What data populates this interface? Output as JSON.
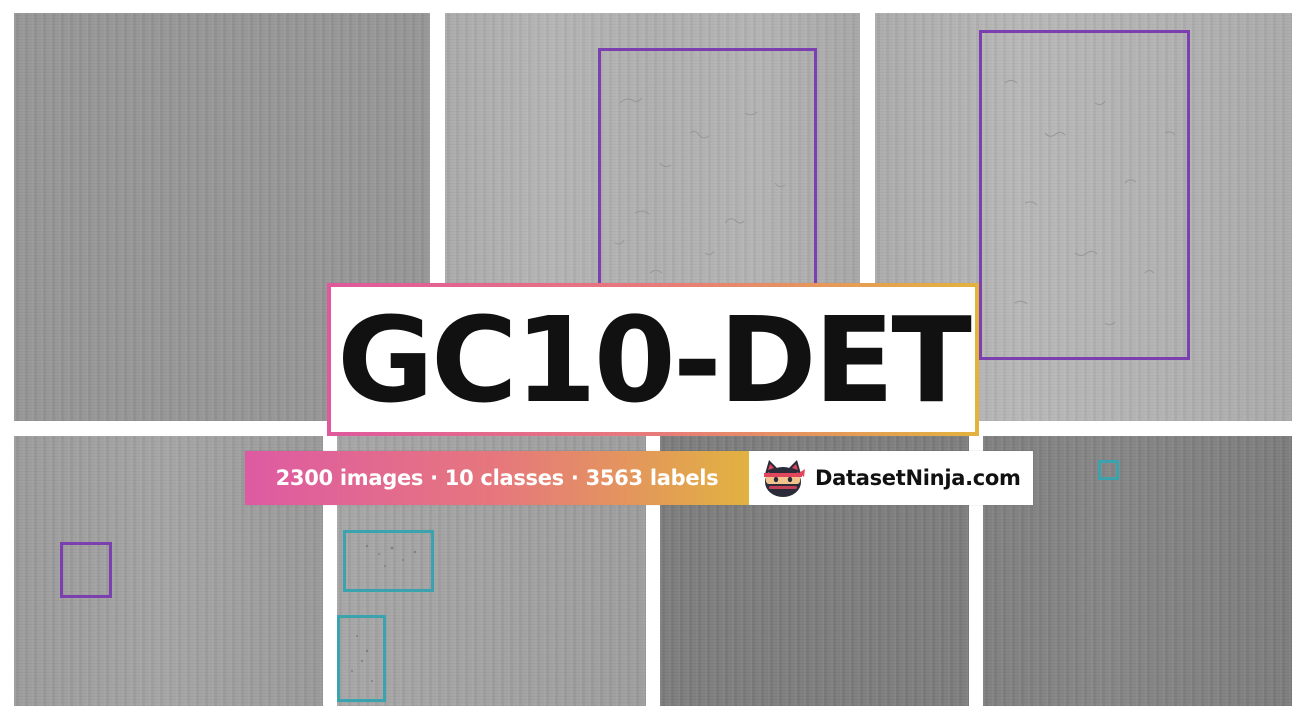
{
  "title": "GC10-DET",
  "stats": {
    "images": "2300 images",
    "classes": "10 classes",
    "labels": "3563 labels",
    "separator": "·"
  },
  "brand": {
    "name": "DatasetNinja.com",
    "logo_icon": "ninja-cat-icon"
  },
  "colors": {
    "gradient_start": "#e0589d",
    "gradient_mid": "#e87a7a",
    "gradient_end": "#e3b33d",
    "bbox_purple": "#7b3fb0",
    "bbox_teal": "#3aa3ad"
  }
}
